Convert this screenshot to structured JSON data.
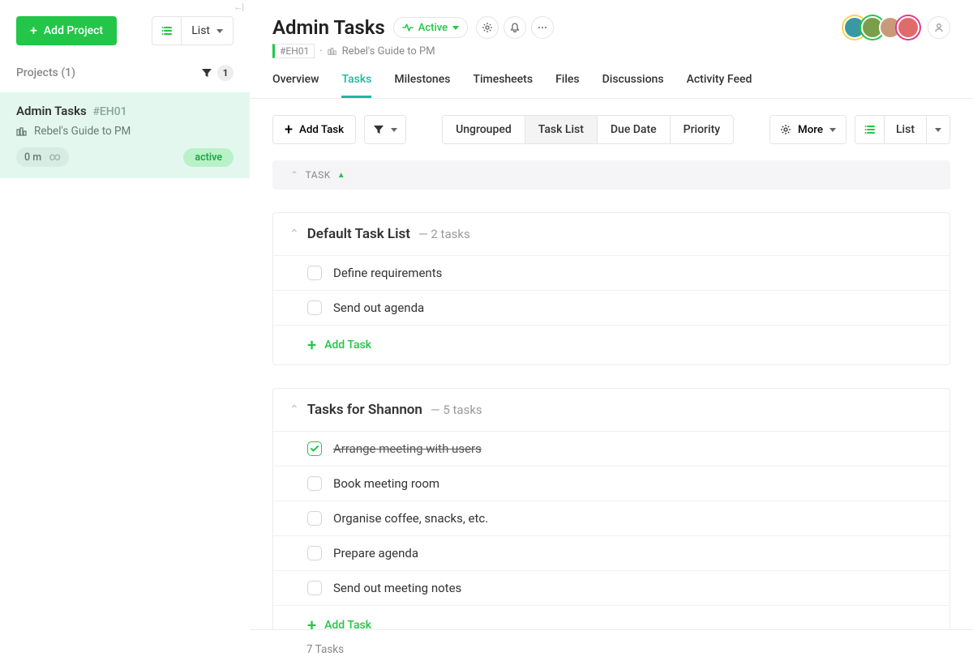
{
  "sidebar": {
    "add_project": "Add Project",
    "view_label": "List",
    "projects_header": "Projects (1)",
    "filter_count": "1",
    "project": {
      "name": "Admin Tasks",
      "hash": "#EH01",
      "parent": "Rebel's Guide to PM",
      "time": "0 m",
      "status": "active"
    }
  },
  "header": {
    "title": "Admin Tasks",
    "active_label": "Active",
    "hash": "#EH01",
    "crumb": "Rebel's Guide to PM"
  },
  "tabs": [
    "Overview",
    "Tasks",
    "Milestones",
    "Timesheets",
    "Files",
    "Discussions",
    "Activity Feed"
  ],
  "active_tab_index": 1,
  "toolbar": {
    "add_task": "Add Task",
    "grouping": [
      "Ungrouped",
      "Task List",
      "Due Date",
      "Priority"
    ],
    "grouping_active_index": 1,
    "more": "More",
    "list_label": "List"
  },
  "column_header": "TASK",
  "groups": [
    {
      "title": "Default Task List",
      "count_label": "2 tasks",
      "tasks": [
        {
          "name": "Define requirements",
          "done": false
        },
        {
          "name": "Send out agenda",
          "done": false
        }
      ],
      "add_label": "Add Task"
    },
    {
      "title": "Tasks for Shannon",
      "count_label": "5 tasks",
      "tasks": [
        {
          "name": "Arrange meeting with users",
          "done": true
        },
        {
          "name": "Book meeting room",
          "done": false
        },
        {
          "name": "Organise coffee, snacks, etc.",
          "done": false
        },
        {
          "name": "Prepare agenda",
          "done": false
        },
        {
          "name": "Send out meeting notes",
          "done": false
        }
      ],
      "add_label": "Add Task"
    }
  ],
  "footer": {
    "total": "7 Tasks"
  }
}
